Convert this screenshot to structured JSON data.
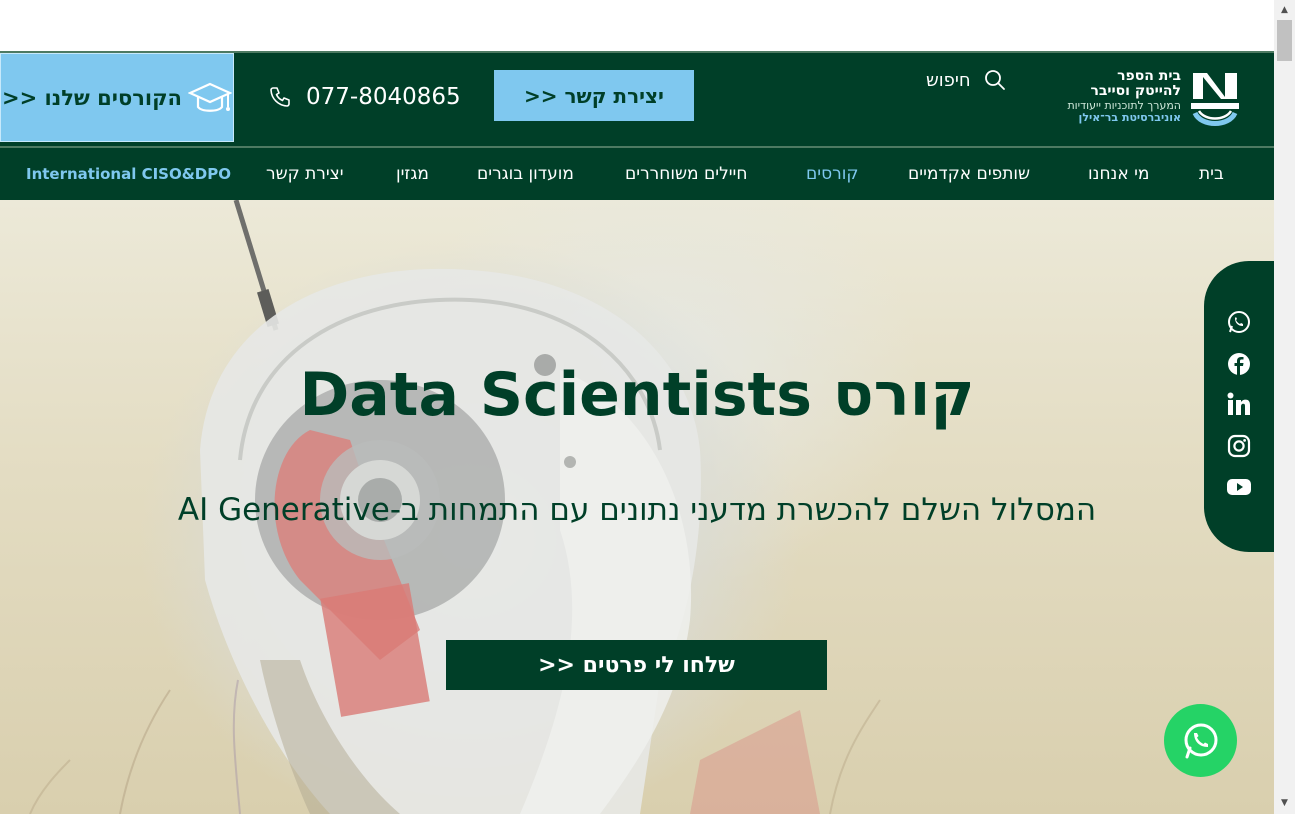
{
  "header": {
    "courses_button": "הקורסים שלנו <<",
    "phone": "077-8040865",
    "contact_button": "יצירת קשר <<",
    "search_label": "חיפוש",
    "logo": {
      "line1": "בית הספר",
      "line2": "להייטק וסייבר",
      "line3": "המערך לתוכניות ייעודיות",
      "line4": "אוניברסיטת בר־אילן"
    }
  },
  "nav": {
    "items": [
      {
        "label": "בית",
        "active": false
      },
      {
        "label": "מי אנחנו",
        "active": false
      },
      {
        "label": "שותפים אקדמיים",
        "active": false
      },
      {
        "label": "קורסים",
        "active": true
      },
      {
        "label": "חיילים משוחררים",
        "active": false
      },
      {
        "label": "מועדון בוגרים",
        "active": false
      },
      {
        "label": "מגזין",
        "active": false
      },
      {
        "label": "יצירת קשר",
        "active": false
      },
      {
        "label": "International CISO&DPO",
        "active": false
      }
    ]
  },
  "hero": {
    "title": "קורס Data Scientists",
    "subtitle": "המסלול השלם להכשרת מדעני נתונים עם התמחות ב-AI Generative",
    "cta": "שלחו לי פרטים <<"
  },
  "social": [
    "whatsapp-icon",
    "facebook-icon",
    "linkedin-icon",
    "instagram-icon",
    "youtube-icon"
  ],
  "colors": {
    "primary": "#003f28",
    "accent": "#7fc8ef",
    "whatsapp": "#25d366"
  }
}
